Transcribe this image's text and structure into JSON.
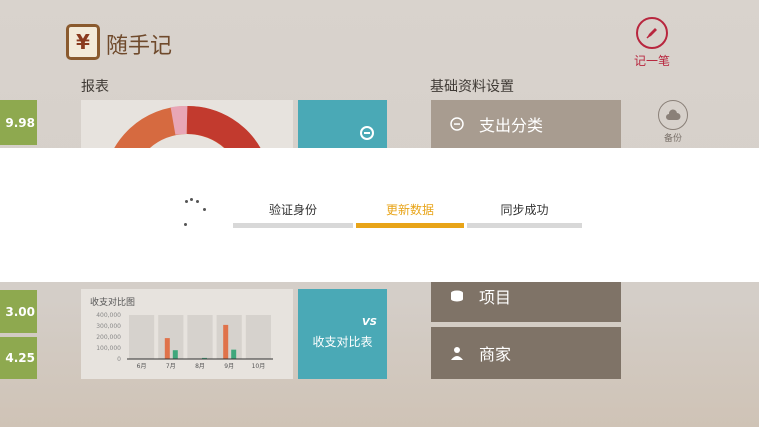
{
  "header": {
    "logo_glyph": "¥",
    "app_name": "随手记",
    "record_label": "记一笔",
    "pen_icon": "pen-icon"
  },
  "report": {
    "title": "报表",
    "left_values": [
      "9.98",
      "3.00",
      "4.25"
    ],
    "compare_tile_label": "收支对比表",
    "compare_tile_icon": "VS"
  },
  "settings": {
    "title": "基础资料设置",
    "backup_label": "备份",
    "items": [
      {
        "label": "支出分类",
        "icon": "minus-circle-icon"
      },
      {
        "label": "项目",
        "icon": "database-icon"
      },
      {
        "label": "商家",
        "icon": "person-icon"
      }
    ]
  },
  "chart_data": {
    "type": "bar",
    "title": "收支对比图",
    "categories": [
      "6月",
      "7月",
      "8月",
      "9月",
      "10月"
    ],
    "yticks": [
      "400,000",
      "300,000",
      "200,000",
      "100,000",
      "0"
    ],
    "ylim": [
      0,
      400000
    ],
    "series": [
      {
        "values": [
          0,
          190000,
          0,
          310000,
          0
        ],
        "color": "#e0734b"
      },
      {
        "values": [
          0,
          80000,
          10000,
          85000,
          0
        ],
        "color": "#3ea77c"
      }
    ],
    "colors": {
      "orange": "#e0734b",
      "green": "#3ea77c"
    }
  },
  "sync": {
    "steps": [
      {
        "label": "验证身份",
        "active": false
      },
      {
        "label": "更新数据",
        "active": true
      },
      {
        "label": "同步成功",
        "active": false
      }
    ],
    "accent": "#e8a418"
  }
}
